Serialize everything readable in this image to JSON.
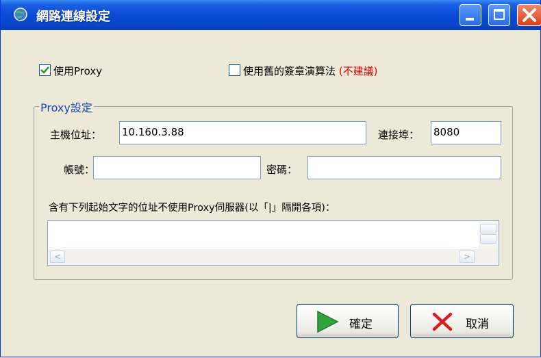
{
  "window": {
    "title": "網路連線設定",
    "icons": {
      "app": "globe-icon",
      "minimize": "minimize-icon",
      "maximize": "maximize-icon",
      "close": "close-icon"
    }
  },
  "options": {
    "use_proxy": {
      "label": "使用Proxy",
      "checked": true
    },
    "legacy_signature": {
      "label": "使用舊的簽章演算法",
      "warning": "(不建議)",
      "checked": false
    }
  },
  "proxy": {
    "group_title": "Proxy設定",
    "host_label": "主機位址：",
    "host_value": "10.160.3.88",
    "port_label": "連接埠：",
    "port_value": "8080",
    "account_label": "帳號：",
    "account_value": "",
    "password_label": "密碼：",
    "password_value": "",
    "bypass_label": "含有下列起始文字的位址不使用Proxy伺服器(以「|」隔開各項)：",
    "bypass_value": ""
  },
  "buttons": {
    "ok_label": "確定",
    "ok_icon": "play-arrow-icon",
    "cancel_label": "取消",
    "cancel_icon": "x-icon"
  },
  "colors": {
    "titlebar": "#0a4bd6",
    "warning": "#e00000",
    "group_title": "#1c47b0",
    "ok_icon": "#2ea43b",
    "cancel_icon": "#d42020"
  }
}
